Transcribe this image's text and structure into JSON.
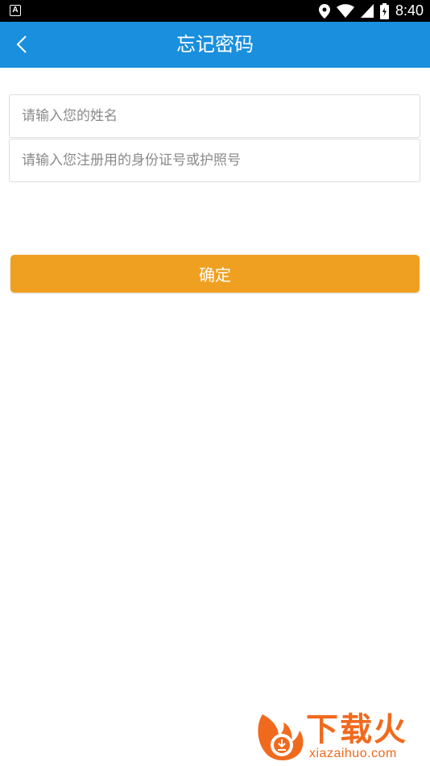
{
  "status_bar": {
    "notification_icon": "A",
    "time": "8:40",
    "icons": [
      "location-icon",
      "wifi-icon",
      "signal-icon",
      "battery-icon"
    ]
  },
  "app_bar": {
    "title": "忘记密码",
    "back_icon": "chevron-left-icon",
    "background": "#1a8fde"
  },
  "form": {
    "name_field": {
      "value": "",
      "placeholder": "请输入您的姓名"
    },
    "id_field": {
      "value": "",
      "placeholder": "请输入您注册用的身份证号或护照号"
    }
  },
  "confirm_button": {
    "label": "确定",
    "color": "#f0a020"
  },
  "watermark": {
    "brand": "下载火",
    "domain": "xiazaihuo.com",
    "color": "#f06a1e"
  }
}
